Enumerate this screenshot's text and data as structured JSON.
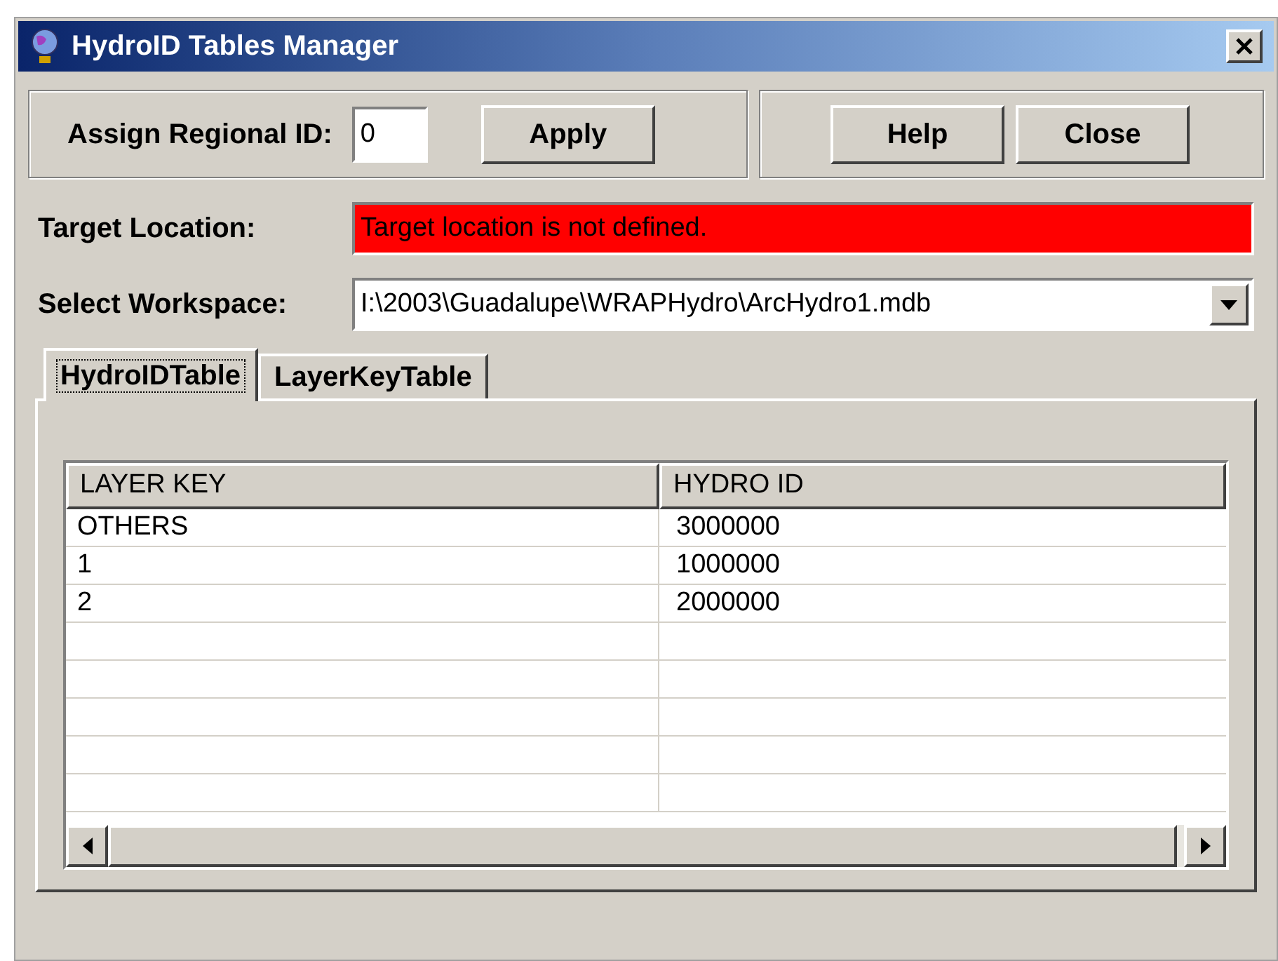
{
  "window": {
    "title": "HydroID Tables Manager"
  },
  "regional_id": {
    "label": "Assign Regional ID:",
    "value": "0",
    "button": "Apply"
  },
  "buttons": [
    "Help",
    "Close"
  ],
  "target_location": {
    "label": "Target Location:",
    "message": "Target location is not defined.",
    "error": true
  },
  "workspace": {
    "label": "Select Workspace:",
    "value": "I:\\2003\\Guadalupe\\WRAPHydro\\ArcHydro1.mdb"
  },
  "tabs": [
    {
      "label": "HydroIDTable",
      "selected": true
    },
    {
      "label": "LayerKeyTable",
      "selected": false
    }
  ],
  "table": {
    "columns": [
      "LAYER KEY",
      "HYDRO ID"
    ],
    "rows": [
      [
        "OTHERS",
        "3000000"
      ],
      [
        "1",
        "1000000"
      ],
      [
        "2",
        "2000000"
      ]
    ]
  }
}
